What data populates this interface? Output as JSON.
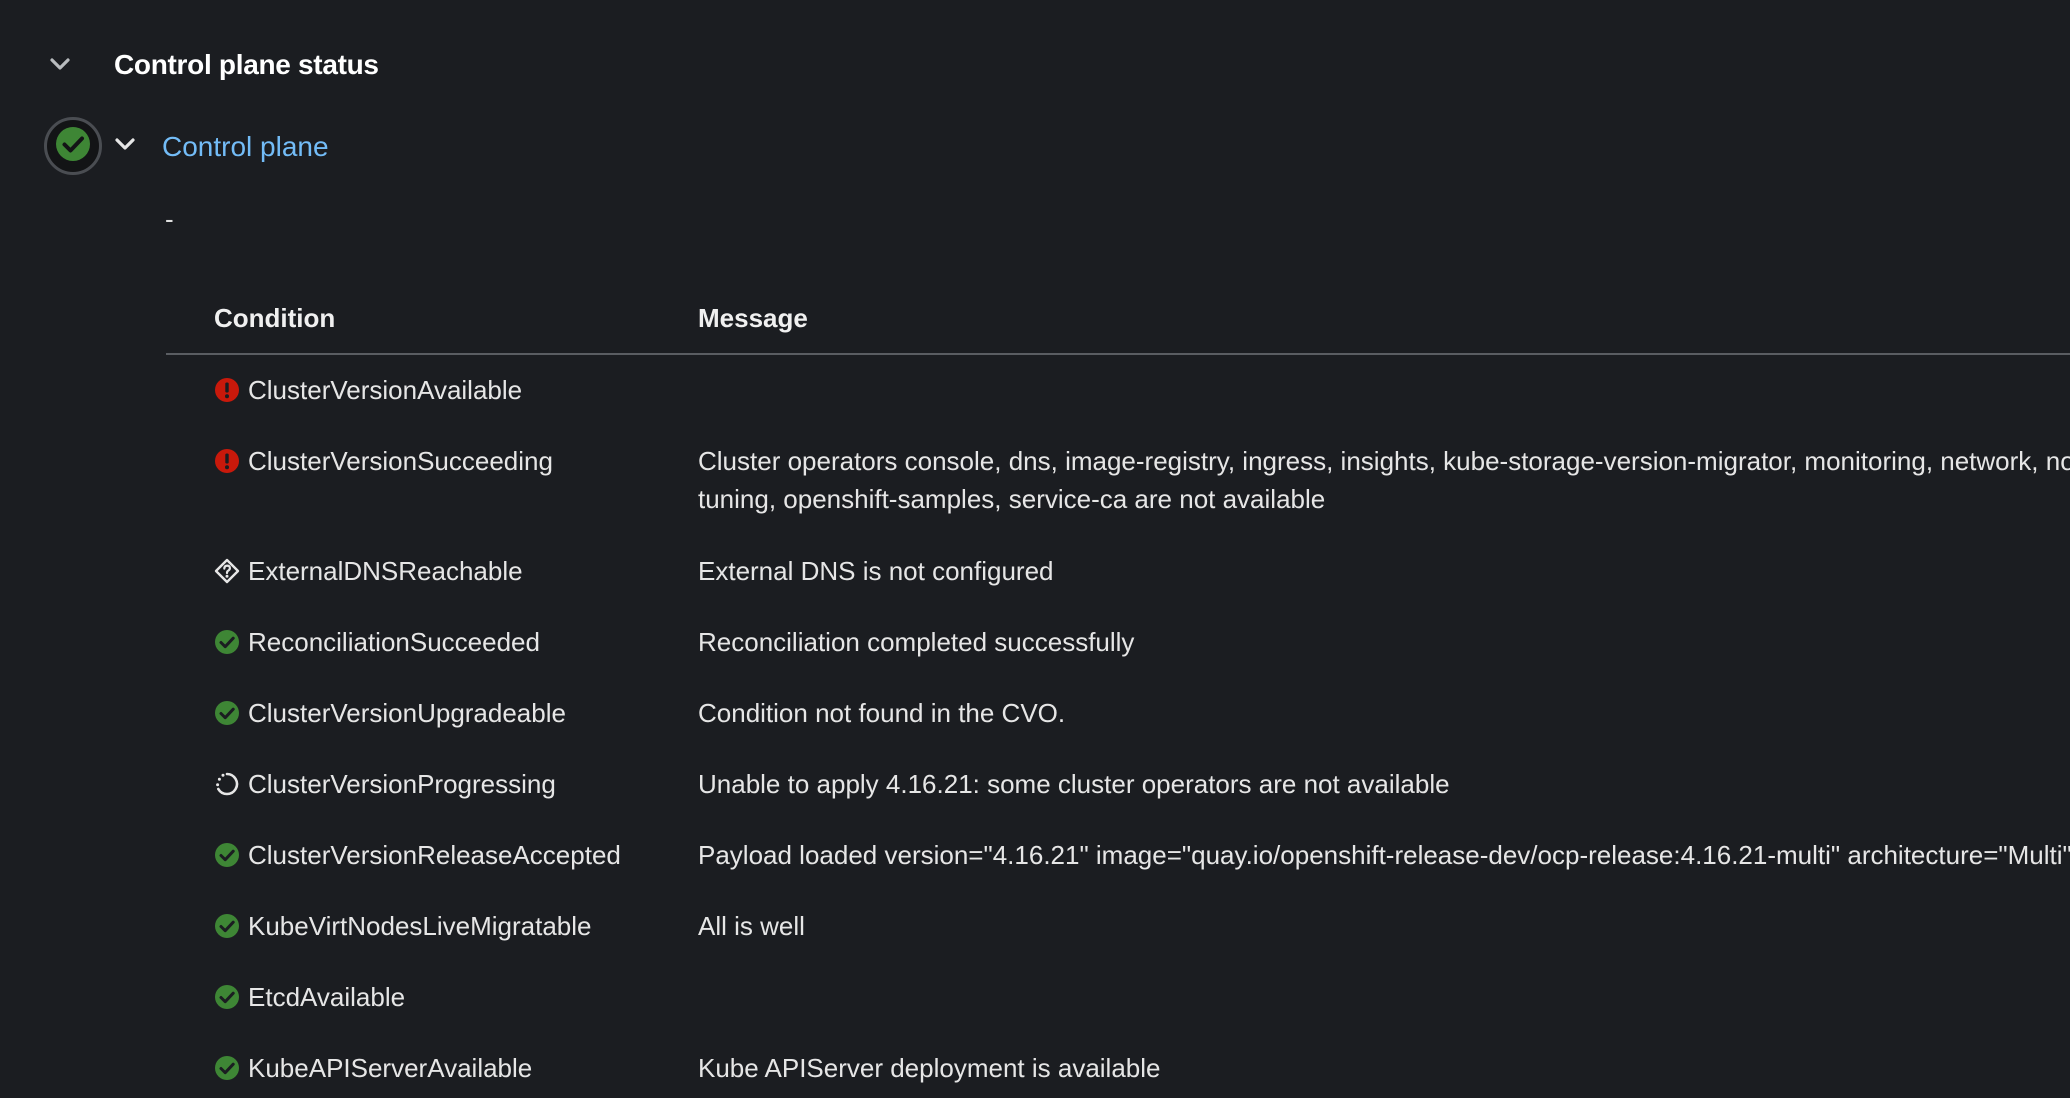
{
  "section": {
    "title": "Control plane status",
    "toggle_icon": "chevron-down-icon"
  },
  "control_plane": {
    "status_icon": "check-circle-icon",
    "status_color": "#3e8635",
    "link_label": "Control plane",
    "description": "-"
  },
  "table": {
    "headers": {
      "condition": "Condition",
      "message": "Message"
    },
    "rows": [
      {
        "condition": "ClusterVersionAvailable",
        "status": "error",
        "icon": "exclamation-circle-icon",
        "message": ""
      },
      {
        "condition": "ClusterVersionSucceeding",
        "status": "error",
        "icon": "exclamation-circle-icon",
        "message_lines": [
          "Cluster operators console, dns, image-registry, ingress, insights, kube-storage-version-migrator, monitoring, network, no",
          "tuning, openshift-samples, service-ca are not available"
        ]
      },
      {
        "condition": "ExternalDNSReachable",
        "status": "unknown",
        "icon": "question-diamond-icon",
        "message": "External DNS is not configured"
      },
      {
        "condition": "ReconciliationSucceeded",
        "status": "success",
        "icon": "check-circle-icon",
        "message": "Reconciliation completed successfully"
      },
      {
        "condition": "ClusterVersionUpgradeable",
        "status": "success",
        "icon": "check-circle-icon",
        "message": "Condition not found in the CVO."
      },
      {
        "condition": "ClusterVersionProgressing",
        "status": "progress",
        "icon": "in-progress-icon",
        "message": "Unable to apply 4.16.21: some cluster operators are not available"
      },
      {
        "condition": "ClusterVersionReleaseAccepted",
        "status": "success",
        "icon": "check-circle-icon",
        "message": "Payload loaded version=\"4.16.21\" image=\"quay.io/openshift-release-dev/ocp-release:4.16.21-multi\" architecture=\"Multi\""
      },
      {
        "condition": "KubeVirtNodesLiveMigratable",
        "status": "success",
        "icon": "check-circle-icon",
        "message": "All is well"
      },
      {
        "condition": "EtcdAvailable",
        "status": "success",
        "icon": "check-circle-icon",
        "message": ""
      },
      {
        "condition": "KubeAPIServerAvailable",
        "status": "success",
        "icon": "check-circle-icon",
        "message": "Kube APIServer deployment is available"
      }
    ]
  },
  "colors": {
    "background": "#1b1d21",
    "success": "#3e8635",
    "error": "#c9190b",
    "link": "#73bcf7",
    "text": "#e6e6e6",
    "heading": "#ffffff"
  }
}
